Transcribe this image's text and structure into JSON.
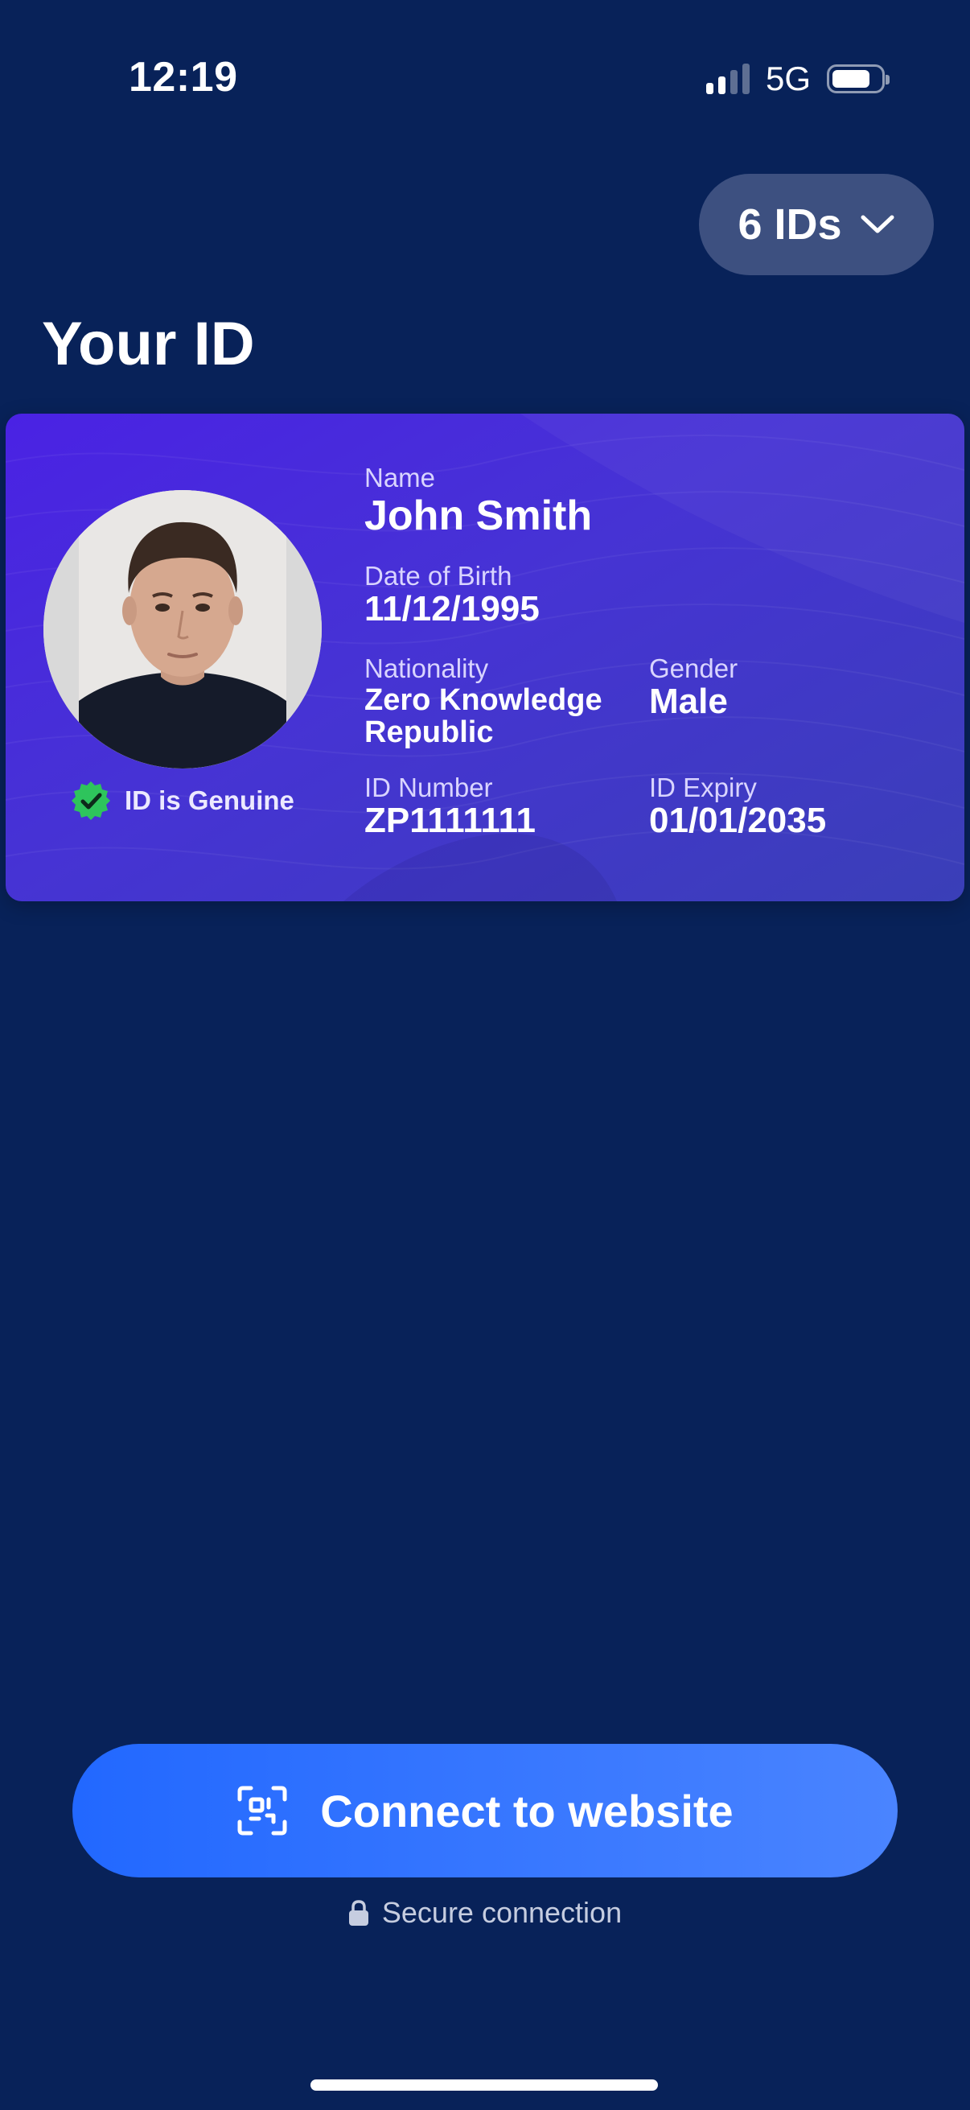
{
  "status_bar": {
    "time": "12:19",
    "network": "5G",
    "signal_bars_active": 2,
    "signal_bars_total": 4,
    "battery_level": 0.7
  },
  "ids_selector": {
    "label": "6 IDs",
    "icon": "chevron-down-icon"
  },
  "page_title": "Your ID",
  "card": {
    "verification": {
      "label": "ID is Genuine",
      "icon": "verified-badge-icon",
      "color": "#2ec45c"
    },
    "name": {
      "label": "Name",
      "value": "John Smith"
    },
    "dob": {
      "label": "Date of Birth",
      "value": "11/12/1995"
    },
    "nationality": {
      "label": "Nationality",
      "value_line1": "Zero Knowledge",
      "value_line2": "Republic"
    },
    "gender": {
      "label": "Gender",
      "value": "Male"
    },
    "id_number": {
      "label": "ID Number",
      "value": "ZP1111111"
    },
    "id_expiry": {
      "label": "ID Expiry",
      "value": "01/01/2035"
    }
  },
  "connect_button": {
    "label": "Connect to website",
    "icon": "scan-qr-icon"
  },
  "secure_note": {
    "label": "Secure connection",
    "icon": "lock-icon"
  },
  "colors": {
    "background": "#082259",
    "card_accent": "#4a22e4",
    "button": "#2268ff",
    "pill": "#3d5080"
  }
}
